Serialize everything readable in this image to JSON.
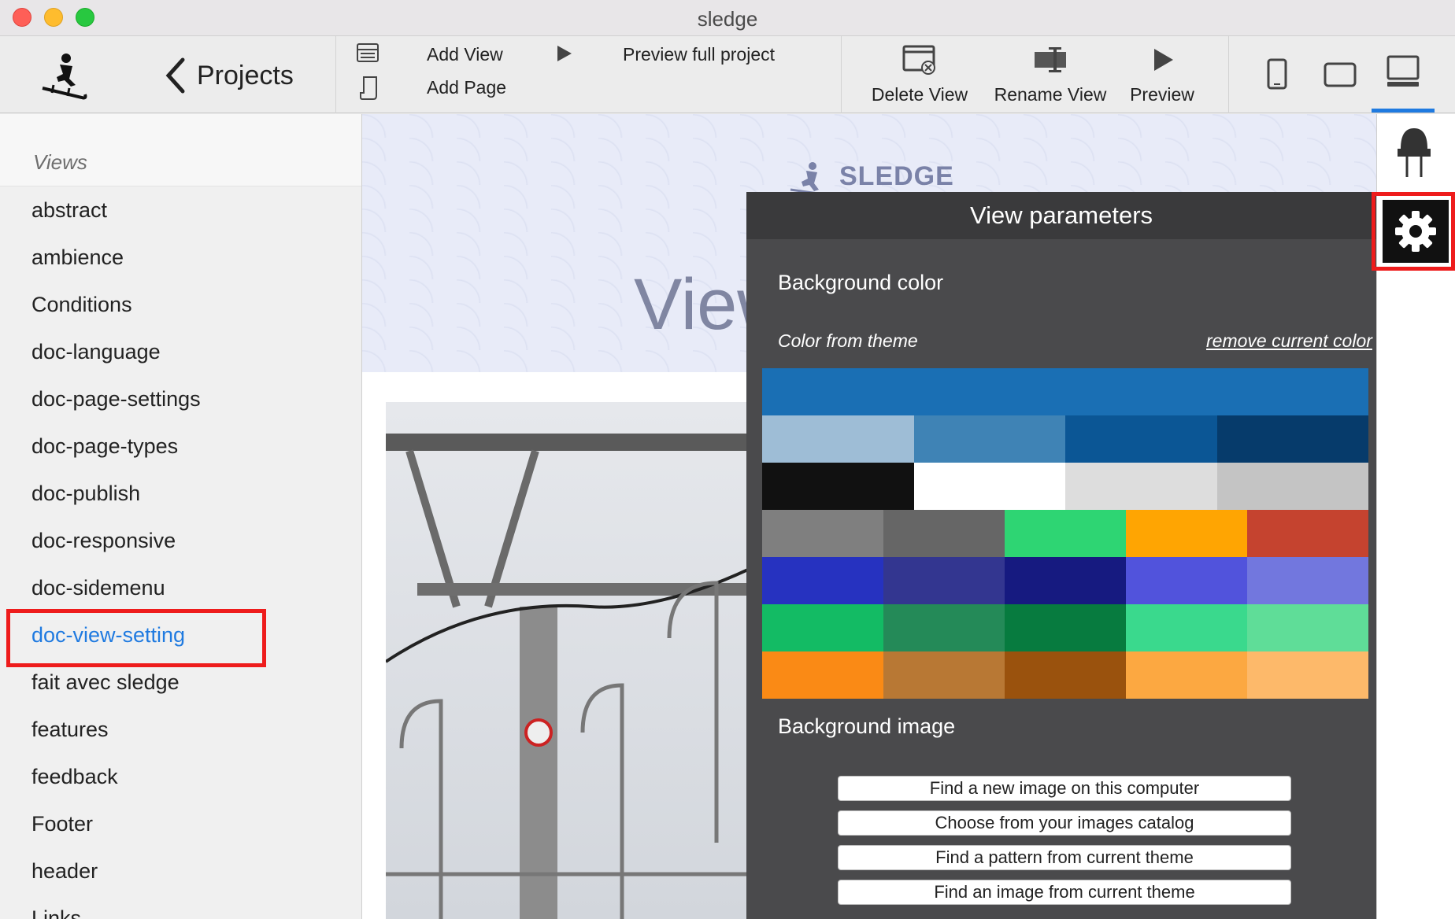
{
  "window": {
    "title": "sledge"
  },
  "toolbar": {
    "projects_label": "Projects",
    "add_view": "Add View",
    "add_page": "Add Page",
    "preview_full": "Preview full project",
    "delete_view": "Delete View",
    "rename_view": "Rename View",
    "preview": "Preview"
  },
  "sidebar": {
    "heading": "Views",
    "items": [
      "abstract",
      "ambience",
      "Conditions",
      "doc-language",
      "doc-page-settings",
      "doc-page-types",
      "doc-publish",
      "doc-responsive",
      "doc-sidemenu",
      "doc-view-setting",
      "fait avec sledge",
      "features",
      "feedback",
      "Footer",
      "header",
      "Links"
    ],
    "selected": "doc-view-setting"
  },
  "canvas": {
    "brand": "SLEDGE",
    "hero_title": "View settings."
  },
  "panel": {
    "title": "View parameters",
    "bg_color_title": "Background color",
    "color_from_theme": "Color from theme",
    "remove_link": "remove current color",
    "bg_image_title": "Background image",
    "buttons": [
      "Find a new image on this computer",
      "Choose from your images catalog",
      "Find a pattern from current theme",
      "Find an image from current theme"
    ]
  },
  "colors": {
    "accent": "#1f7ae0",
    "highlight": "#ee1c1c",
    "swatch_rows": [
      [
        "#1a6fb4"
      ],
      [
        "#9ebdd6",
        "#3f83b5",
        "#0b5695",
        "#063b6b"
      ],
      [
        "#111111",
        "#ffffff",
        "#dddddd",
        "#c4c4c4"
      ],
      [
        "#7f7f7f",
        "#666666",
        "#2ed573",
        "#ffa502",
        "#c5432f"
      ],
      [
        "#2632c0",
        "#333690",
        "#161a80",
        "#5153dc",
        "#7277de"
      ],
      [
        "#13bb64",
        "#248a58",
        "#077b3f",
        "#3ad98d",
        "#5fdd98"
      ],
      [
        "#fa8a15",
        "#b87834",
        "#9a520d",
        "#fca841",
        "#fdb96a"
      ]
    ]
  }
}
